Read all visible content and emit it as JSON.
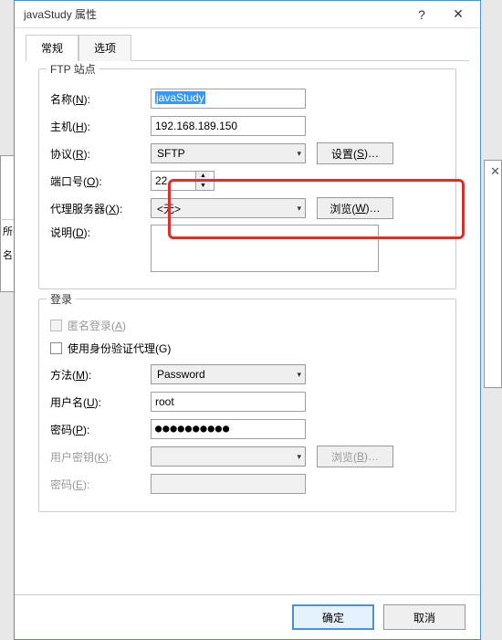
{
  "title": "javaStudy 属性",
  "titlebar": {
    "help": "?",
    "close": "✕"
  },
  "tabs": {
    "general": "常规",
    "options": "选项"
  },
  "ftp": {
    "legend": "FTP 站点",
    "name_label": "名称(N):",
    "name_value": "javaStudy",
    "host_label": "主机(H):",
    "host_value": "192.168.189.150",
    "protocol_label": "协议(R):",
    "protocol_value": "SFTP",
    "settings_btn": "设置(S)...",
    "port_label": "端口号(O):",
    "port_value": "22",
    "proxy_label": "代理服务器(X):",
    "proxy_value": "<无>",
    "browse_btn": "浏览(W)...",
    "desc_label": "说明(D):",
    "desc_value": ""
  },
  "login": {
    "legend": "登录",
    "anon_label": "匿名登录(A)",
    "useauth_label": "使用身份验证代理(G)",
    "method_label": "方法(M):",
    "method_value": "Password",
    "user_label": "用户名(U):",
    "user_value": "root",
    "pwd_label": "密码(P):",
    "pwd_value": "●●●●●●●●●●",
    "userkey_label": "用户密钥(K):",
    "userkey_value": "",
    "browse2_btn": "浏览(B)...",
    "pwd2_label": "密码(E):",
    "pwd2_value": ""
  },
  "footer": {
    "ok": "确定",
    "cancel": "取消"
  },
  "bg": {
    "col_name": "名",
    "all": "所有"
  }
}
